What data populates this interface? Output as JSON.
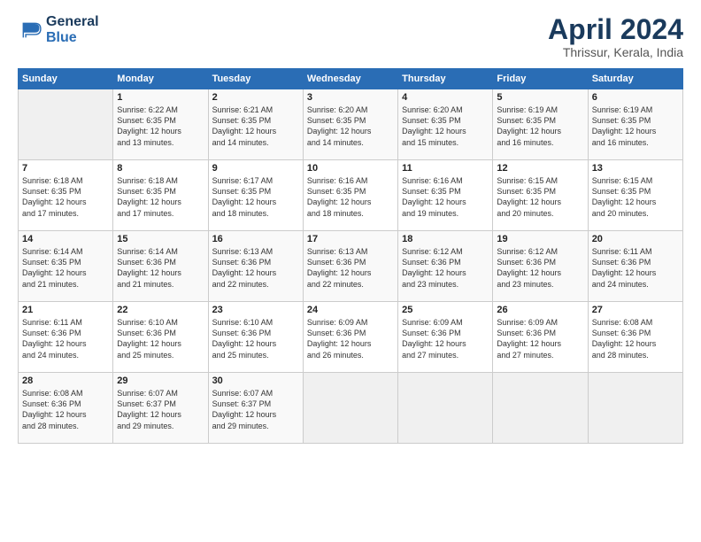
{
  "header": {
    "logo_line1": "General",
    "logo_line2": "Blue",
    "main_title": "April 2024",
    "subtitle": "Thrissur, Kerala, India"
  },
  "calendar": {
    "days_of_week": [
      "Sunday",
      "Monday",
      "Tuesday",
      "Wednesday",
      "Thursday",
      "Friday",
      "Saturday"
    ],
    "weeks": [
      [
        {
          "day": "",
          "info": ""
        },
        {
          "day": "1",
          "info": "Sunrise: 6:22 AM\nSunset: 6:35 PM\nDaylight: 12 hours\nand 13 minutes."
        },
        {
          "day": "2",
          "info": "Sunrise: 6:21 AM\nSunset: 6:35 PM\nDaylight: 12 hours\nand 14 minutes."
        },
        {
          "day": "3",
          "info": "Sunrise: 6:20 AM\nSunset: 6:35 PM\nDaylight: 12 hours\nand 14 minutes."
        },
        {
          "day": "4",
          "info": "Sunrise: 6:20 AM\nSunset: 6:35 PM\nDaylight: 12 hours\nand 15 minutes."
        },
        {
          "day": "5",
          "info": "Sunrise: 6:19 AM\nSunset: 6:35 PM\nDaylight: 12 hours\nand 16 minutes."
        },
        {
          "day": "6",
          "info": "Sunrise: 6:19 AM\nSunset: 6:35 PM\nDaylight: 12 hours\nand 16 minutes."
        }
      ],
      [
        {
          "day": "7",
          "info": "Sunrise: 6:18 AM\nSunset: 6:35 PM\nDaylight: 12 hours\nand 17 minutes."
        },
        {
          "day": "8",
          "info": "Sunrise: 6:18 AM\nSunset: 6:35 PM\nDaylight: 12 hours\nand 17 minutes."
        },
        {
          "day": "9",
          "info": "Sunrise: 6:17 AM\nSunset: 6:35 PM\nDaylight: 12 hours\nand 18 minutes."
        },
        {
          "day": "10",
          "info": "Sunrise: 6:16 AM\nSunset: 6:35 PM\nDaylight: 12 hours\nand 18 minutes."
        },
        {
          "day": "11",
          "info": "Sunrise: 6:16 AM\nSunset: 6:35 PM\nDaylight: 12 hours\nand 19 minutes."
        },
        {
          "day": "12",
          "info": "Sunrise: 6:15 AM\nSunset: 6:35 PM\nDaylight: 12 hours\nand 20 minutes."
        },
        {
          "day": "13",
          "info": "Sunrise: 6:15 AM\nSunset: 6:35 PM\nDaylight: 12 hours\nand 20 minutes."
        }
      ],
      [
        {
          "day": "14",
          "info": "Sunrise: 6:14 AM\nSunset: 6:35 PM\nDaylight: 12 hours\nand 21 minutes."
        },
        {
          "day": "15",
          "info": "Sunrise: 6:14 AM\nSunset: 6:36 PM\nDaylight: 12 hours\nand 21 minutes."
        },
        {
          "day": "16",
          "info": "Sunrise: 6:13 AM\nSunset: 6:36 PM\nDaylight: 12 hours\nand 22 minutes."
        },
        {
          "day": "17",
          "info": "Sunrise: 6:13 AM\nSunset: 6:36 PM\nDaylight: 12 hours\nand 22 minutes."
        },
        {
          "day": "18",
          "info": "Sunrise: 6:12 AM\nSunset: 6:36 PM\nDaylight: 12 hours\nand 23 minutes."
        },
        {
          "day": "19",
          "info": "Sunrise: 6:12 AM\nSunset: 6:36 PM\nDaylight: 12 hours\nand 23 minutes."
        },
        {
          "day": "20",
          "info": "Sunrise: 6:11 AM\nSunset: 6:36 PM\nDaylight: 12 hours\nand 24 minutes."
        }
      ],
      [
        {
          "day": "21",
          "info": "Sunrise: 6:11 AM\nSunset: 6:36 PM\nDaylight: 12 hours\nand 24 minutes."
        },
        {
          "day": "22",
          "info": "Sunrise: 6:10 AM\nSunset: 6:36 PM\nDaylight: 12 hours\nand 25 minutes."
        },
        {
          "day": "23",
          "info": "Sunrise: 6:10 AM\nSunset: 6:36 PM\nDaylight: 12 hours\nand 25 minutes."
        },
        {
          "day": "24",
          "info": "Sunrise: 6:09 AM\nSunset: 6:36 PM\nDaylight: 12 hours\nand 26 minutes."
        },
        {
          "day": "25",
          "info": "Sunrise: 6:09 AM\nSunset: 6:36 PM\nDaylight: 12 hours\nand 27 minutes."
        },
        {
          "day": "26",
          "info": "Sunrise: 6:09 AM\nSunset: 6:36 PM\nDaylight: 12 hours\nand 27 minutes."
        },
        {
          "day": "27",
          "info": "Sunrise: 6:08 AM\nSunset: 6:36 PM\nDaylight: 12 hours\nand 28 minutes."
        }
      ],
      [
        {
          "day": "28",
          "info": "Sunrise: 6:08 AM\nSunset: 6:36 PM\nDaylight: 12 hours\nand 28 minutes."
        },
        {
          "day": "29",
          "info": "Sunrise: 6:07 AM\nSunset: 6:37 PM\nDaylight: 12 hours\nand 29 minutes."
        },
        {
          "day": "30",
          "info": "Sunrise: 6:07 AM\nSunset: 6:37 PM\nDaylight: 12 hours\nand 29 minutes."
        },
        {
          "day": "",
          "info": ""
        },
        {
          "day": "",
          "info": ""
        },
        {
          "day": "",
          "info": ""
        },
        {
          "day": "",
          "info": ""
        }
      ]
    ]
  }
}
